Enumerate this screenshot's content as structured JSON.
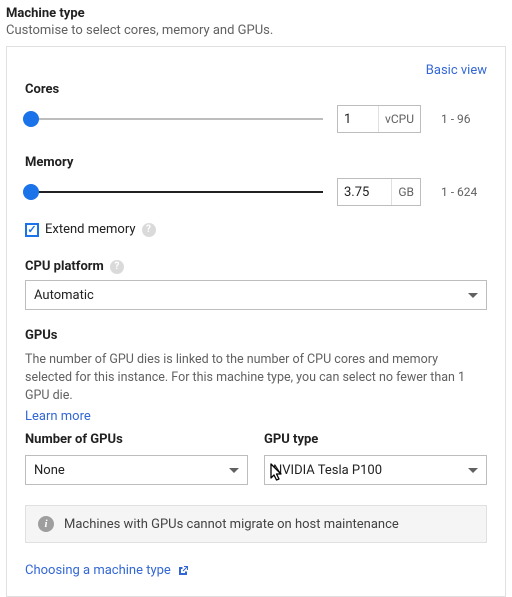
{
  "header": {
    "title": "Machine type",
    "subtitle": "Customise to select cores, memory and GPUs."
  },
  "basic_view_link": "Basic view",
  "cores": {
    "label": "Cores",
    "value": "1",
    "unit": "vCPU",
    "range": "1 - 96"
  },
  "memory": {
    "label": "Memory",
    "value": "3.75",
    "unit": "GB",
    "range": "1 - 624"
  },
  "extend_memory": {
    "label": "Extend memory",
    "checked": true
  },
  "cpu_platform": {
    "label": "CPU platform",
    "value": "Automatic"
  },
  "gpus": {
    "label": "GPUs",
    "desc": "The number of GPU dies is linked to the number of CPU cores and memory selected for this instance. For this machine type, you can select no fewer than 1 GPU die.",
    "learn_more": "Learn more",
    "number_label": "Number of GPUs",
    "number_value": "None",
    "type_label": "GPU type",
    "type_value": "NVIDIA Tesla P100"
  },
  "banner": "Machines with GPUs cannot migrate on host maintenance",
  "choosing_link": "Choosing a machine type"
}
